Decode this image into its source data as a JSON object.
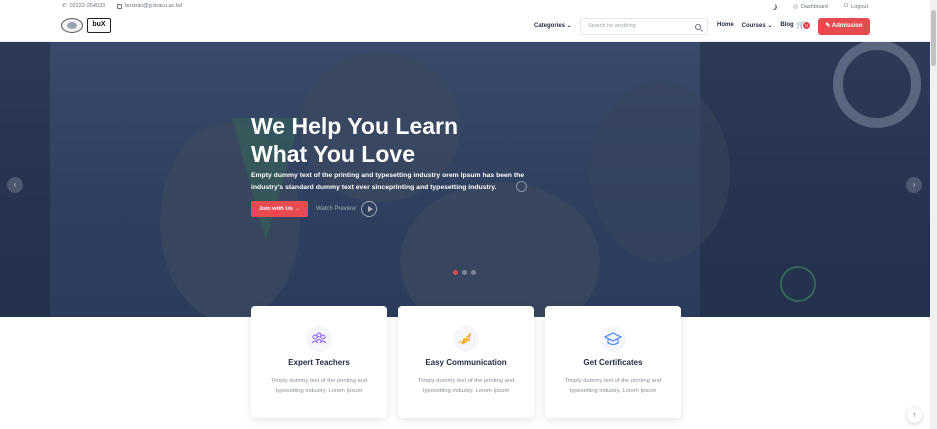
{
  "topbar": {
    "phone": "02222-264033",
    "email": "bustrac@g.bracu.ac.bd",
    "dashboard": "Dashboard",
    "logout": "Logout"
  },
  "navbar": {
    "logo_text": "buX",
    "categories": "Categories ⌄",
    "search_placeholder": "Search for anything",
    "links": [
      "Home",
      "Courses ⌄",
      "Blog"
    ],
    "cart_count": "0",
    "admission": "Admission"
  },
  "hero": {
    "title_line1": "We Help You Learn",
    "title_line2": "What You Love",
    "text": "Empty dummy text of the printing and typesetting industry orem Ipsum has been the industry's standard dummy text ever sinceprinting and typesetting industry.",
    "join_button": "Join with Us →",
    "watch_preview": "Watch Preview",
    "prev_arrow": "‹",
    "next_arrow": "›"
  },
  "features": [
    {
      "title": "Expert Teachers",
      "text": "Timply dummy text of the printing and typesetting industry. Lorem Ipsum",
      "icon": "teachers-icon",
      "color": "#8b5cf6"
    },
    {
      "title": "Easy Communication",
      "text": "Timply dummy text of the printing and typesetting industry. Lorem Ipsum",
      "icon": "rocket-icon",
      "color": "#f59e0b"
    },
    {
      "title": "Get Certificates",
      "text": "Timply dummy text of the printing and typesetting industry. Lorem Ipsum",
      "icon": "graduation-cap-icon",
      "color": "#3b82f6"
    }
  ],
  "scroll_top": "↑",
  "colors": {
    "accent": "#e74b4f",
    "hero_bg": "#2f3f5f",
    "text": "#1f2a44"
  }
}
